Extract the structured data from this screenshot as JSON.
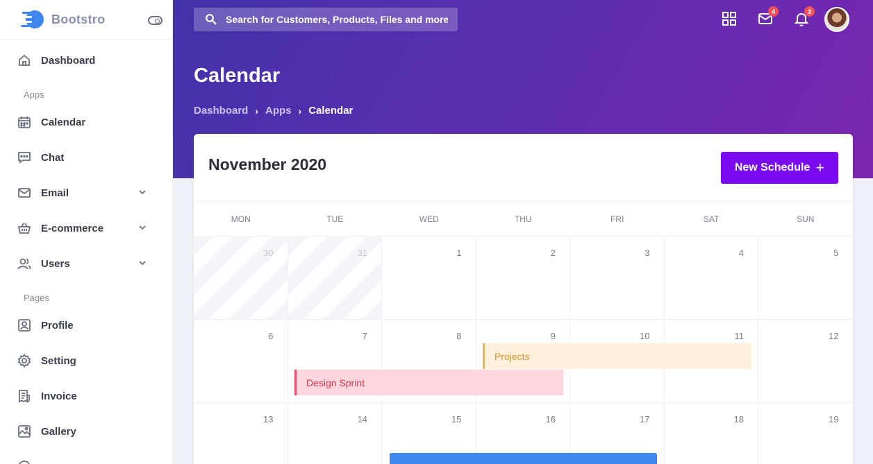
{
  "brand": {
    "name": "Bootstro"
  },
  "sidebar": {
    "items": [
      {
        "label": "Dashboard",
        "icon": "home-icon"
      },
      {
        "section": "Apps"
      },
      {
        "label": "Calendar",
        "icon": "calendar-icon"
      },
      {
        "label": "Chat",
        "icon": "chat-icon"
      },
      {
        "label": "Email",
        "icon": "mail-icon",
        "expandable": true
      },
      {
        "label": "E-commerce",
        "icon": "basket-icon",
        "expandable": true
      },
      {
        "label": "Users",
        "icon": "users-icon",
        "expandable": true
      },
      {
        "section": "Pages"
      },
      {
        "label": "Profile",
        "icon": "profile-icon"
      },
      {
        "label": "Setting",
        "icon": "gear-icon"
      },
      {
        "label": "Invoice",
        "icon": "invoice-icon"
      },
      {
        "label": "Gallery",
        "icon": "gallery-icon"
      }
    ]
  },
  "header": {
    "search_placeholder": "Search for Customers, Products, Files and more.",
    "mail_badge": "4",
    "notification_badge": "3",
    "page_title": "Calendar",
    "breadcrumb": [
      "Dashboard",
      "Apps",
      "Calendar"
    ]
  },
  "calendar": {
    "month": "November 2020",
    "new_button": "New Schedule",
    "weekdays": [
      "MON",
      "TUE",
      "WED",
      "THU",
      "FRI",
      "SAT",
      "SUN"
    ],
    "weeks": [
      [
        "30",
        "31",
        "1",
        "2",
        "3",
        "4",
        "5"
      ],
      [
        "6",
        "7",
        "8",
        "9",
        "10",
        "11",
        "12"
      ],
      [
        "13",
        "14",
        "15",
        "16",
        "17",
        "18",
        "19"
      ]
    ],
    "events": [
      {
        "title": "Projects",
        "start": "9",
        "end": "11",
        "color": "#f4b24b"
      },
      {
        "title": "Design Sprint",
        "start": "7",
        "end": "9",
        "color": "#eb4b68"
      },
      {
        "title": "",
        "start": "15",
        "end": "17",
        "color": "#3f86f0"
      }
    ]
  },
  "colors": {
    "accent": "#7a0af0",
    "header_gradient_start": "#4232a8",
    "header_gradient_end": "#7a26b0"
  }
}
